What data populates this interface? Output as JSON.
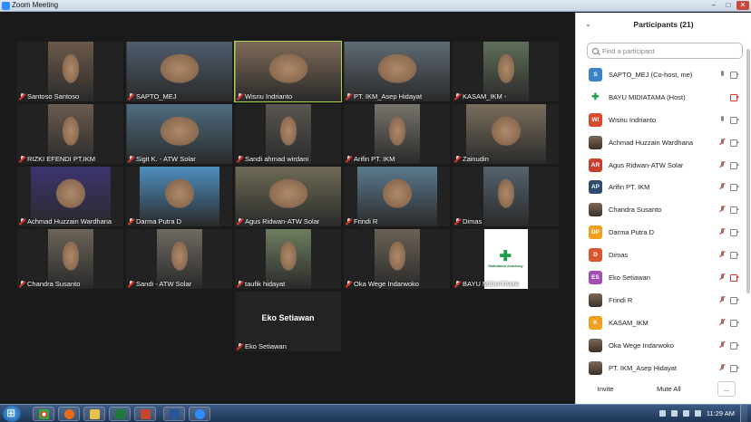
{
  "window": {
    "title": "Zoom Meeting"
  },
  "gallery": {
    "rows": [
      [
        {
          "name": "Santoso Santoso",
          "face": "#6b5a4a",
          "w": 50
        },
        {
          "name": "SAPTO_MEJ",
          "face": "#4f5d6e",
          "w": 117
        },
        {
          "name": "Wisnu Indrianto",
          "face": "#7e6a58",
          "w": 117,
          "active": true
        },
        {
          "name": "PT. IKM_Asep Hidayat",
          "face": "#5e6a73",
          "w": 117
        },
        {
          "name": "KASAM_IKM -",
          "face": "#5f6f58",
          "w": 50
        }
      ],
      [
        {
          "name": "RIZKI EFENDI PT.IKM",
          "face": "#6a5b4e",
          "w": 50
        },
        {
          "name": "Sigit K. - ATW Solar",
          "face": "#4e6d80",
          "w": 117
        },
        {
          "name": "Sandi ahmad wirdani",
          "face": "#5a5650",
          "w": 50
        },
        {
          "name": "Arifin PT. IKM",
          "face": "#77746b",
          "w": 50
        },
        {
          "name": "Zainudin",
          "face": "#7a6e5c",
          "w": 88
        }
      ],
      [
        {
          "name": "Achmad Huzzain Wardhana",
          "face": "#3b3470",
          "w": 88
        },
        {
          "name": "Darma Putra D",
          "face": "#4e8fc0",
          "w": 88
        },
        {
          "name": "Agus Ridwan-ATW Solar",
          "face": "#6e6a55",
          "w": 117
        },
        {
          "name": "Frindi R",
          "face": "#5b7a8f",
          "w": 88
        },
        {
          "name": "Dimas",
          "face": "#54626e",
          "w": 50
        }
      ],
      [
        {
          "name": "Chandra Susanto",
          "face": "#6c6459",
          "w": 50
        },
        {
          "name": "Sandi - ATW Solar",
          "face": "#6f6a61",
          "w": 50
        },
        {
          "name": "taufik hidayat",
          "face": "#6e7d5f",
          "w": 50
        },
        {
          "name": "Oka Wege Indarwoko",
          "face": "#6b6255",
          "w": 50
        },
        {
          "name": "BAYU MIDIATAMA",
          "logo": true,
          "w": 50,
          "logo_text": "Midiatama Academy"
        }
      ],
      [
        {
          "name": "Eko Setiawan",
          "novideo": true
        }
      ]
    ]
  },
  "participants": {
    "title": "Participants (21)",
    "search_placeholder": "Find a participant",
    "items": [
      {
        "name": "SAPTO_MEJ (Co-host, me)",
        "initials": "S",
        "color": "#3b82c6",
        "mic": "on",
        "cam": "on"
      },
      {
        "name": "BAYU MIDIATAMA (Host)",
        "initials": "",
        "color": "#ffffff",
        "logo": true,
        "mic": "none",
        "cam": "off"
      },
      {
        "name": "Wisnu Indrianto",
        "initials": "WI",
        "color": "#d84b2e",
        "mic": "on",
        "cam": "on"
      },
      {
        "name": "Achmad Huzzain Wardhana",
        "initials": "",
        "photo": true,
        "mic": "muted",
        "cam": "on"
      },
      {
        "name": "Agus Ridwan-ATW Solar",
        "initials": "AR",
        "color": "#c8412f",
        "mic": "muted",
        "cam": "on"
      },
      {
        "name": "Arifin PT. IKM",
        "initials": "AP",
        "color": "#2e4c6d",
        "mic": "muted",
        "cam": "on"
      },
      {
        "name": "Chandra Susanto",
        "initials": "",
        "photo": true,
        "mic": "muted",
        "cam": "on"
      },
      {
        "name": "Darma Putra D",
        "initials": "DP",
        "color": "#f0a020",
        "mic": "muted",
        "cam": "on"
      },
      {
        "name": "Dimas",
        "initials": "D",
        "color": "#d9572c",
        "mic": "muted",
        "cam": "on"
      },
      {
        "name": "Eko Setiawan",
        "initials": "ES",
        "color": "#a14fb3",
        "mic": "muted",
        "cam": "off"
      },
      {
        "name": "Frindi R",
        "initials": "",
        "photo": true,
        "mic": "muted",
        "cam": "on"
      },
      {
        "name": "KASAM_IKM",
        "initials": "K",
        "color": "#f0a020",
        "mic": "muted",
        "cam": "on"
      },
      {
        "name": "Oka Wege Indarwoko",
        "initials": "",
        "photo": true,
        "mic": "muted",
        "cam": "on"
      },
      {
        "name": "PT. IKM_Asep Hidayat",
        "initials": "",
        "photo": true,
        "mic": "muted",
        "cam": "on"
      }
    ],
    "invite_label": "Invite",
    "mute_all_label": "Mute All",
    "more_label": "..."
  },
  "taskbar": {
    "clock": "11:29 AM"
  },
  "colors": {
    "active_speaker": "#a6d34a",
    "muted_red": "#e0352c",
    "zoom_blue": "#2d8cff"
  }
}
